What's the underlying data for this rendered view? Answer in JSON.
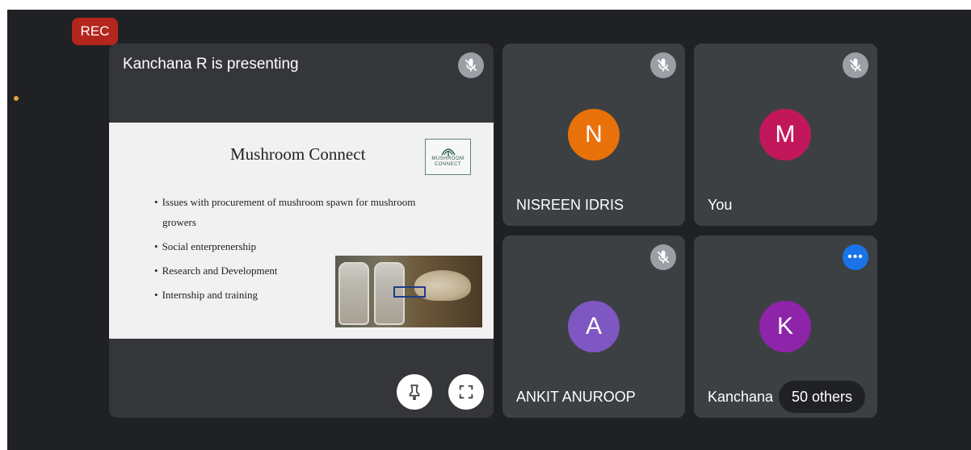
{
  "meeting": {
    "recording_badge": "REC"
  },
  "presentation": {
    "title": "Kanchana R is presenting",
    "slide": {
      "heading": "Mushroom Connect",
      "logo_line1": "MUSHROOM",
      "logo_line2": "CONNECT",
      "bullets": [
        "Issues with procurement of mushroom spawn for mushroom",
        "growers",
        "Social enterprenership",
        "Research and Development",
        "Internship and training"
      ]
    }
  },
  "participants": [
    {
      "name": "NISREEN IDRIS",
      "initial": "N",
      "color": "#e8710a"
    },
    {
      "name": "You",
      "initial": "M",
      "color": "#c2185b"
    },
    {
      "name": "ANKIT ANUROOP",
      "initial": "A",
      "color": "#7e57c2"
    },
    {
      "name": "Kanchana",
      "initial": "K",
      "color": "#8e24aa"
    }
  ],
  "others_label": "50 others",
  "icons": {
    "mic": "mic-off-icon",
    "pin": "pin-icon",
    "fullscreen": "fullscreen-icon",
    "more": "more-options-icon"
  }
}
